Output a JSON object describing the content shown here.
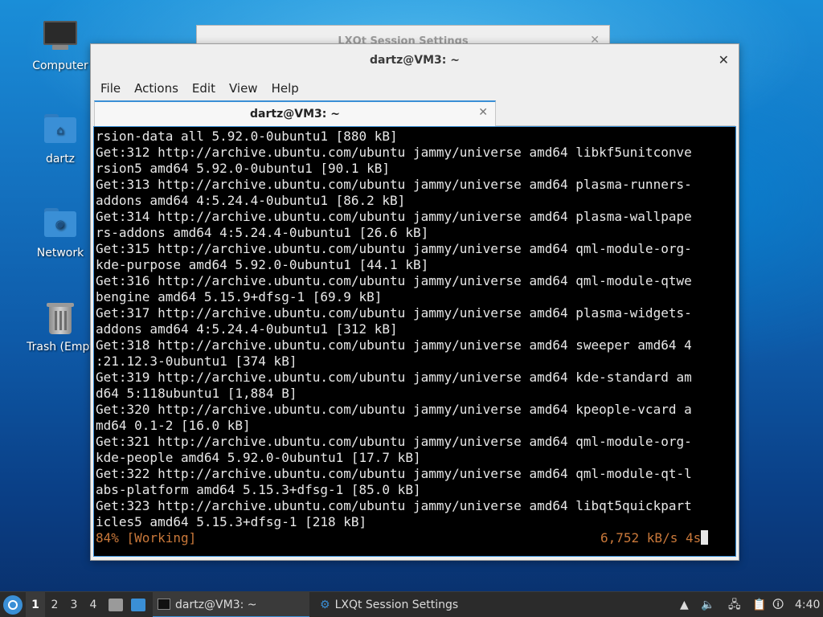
{
  "desktop": {
    "icons": [
      {
        "label": "Computer"
      },
      {
        "label": "dartz"
      },
      {
        "label": "Network"
      },
      {
        "label": "Trash (Empt"
      }
    ]
  },
  "background_window": {
    "title": "LXQt Session Settings"
  },
  "terminal_window": {
    "title": "dartz@VM3: ~",
    "menu": [
      "File",
      "Actions",
      "Edit",
      "View",
      "Help"
    ],
    "tab_title": "dartz@VM3: ~",
    "lines": [
      "rsion-data all 5.92.0-0ubuntu1 [880 kB]",
      "Get:312 http://archive.ubuntu.com/ubuntu jammy/universe amd64 libkf5unitconve",
      "rsion5 amd64 5.92.0-0ubuntu1 [90.1 kB]",
      "Get:313 http://archive.ubuntu.com/ubuntu jammy/universe amd64 plasma-runners-",
      "addons amd64 4:5.24.4-0ubuntu1 [86.2 kB]",
      "Get:314 http://archive.ubuntu.com/ubuntu jammy/universe amd64 plasma-wallpape",
      "rs-addons amd64 4:5.24.4-0ubuntu1 [26.6 kB]",
      "Get:315 http://archive.ubuntu.com/ubuntu jammy/universe amd64 qml-module-org-",
      "kde-purpose amd64 5.92.0-0ubuntu1 [44.1 kB]",
      "Get:316 http://archive.ubuntu.com/ubuntu jammy/universe amd64 qml-module-qtwe",
      "bengine amd64 5.15.9+dfsg-1 [69.9 kB]",
      "Get:317 http://archive.ubuntu.com/ubuntu jammy/universe amd64 plasma-widgets-",
      "addons amd64 4:5.24.4-0ubuntu1 [312 kB]",
      "Get:318 http://archive.ubuntu.com/ubuntu jammy/universe amd64 sweeper amd64 4",
      ":21.12.3-0ubuntu1 [374 kB]",
      "Get:319 http://archive.ubuntu.com/ubuntu jammy/universe amd64 kde-standard am",
      "d64 5:118ubuntu1 [1,884 B]",
      "Get:320 http://archive.ubuntu.com/ubuntu jammy/universe amd64 kpeople-vcard a",
      "md64 0.1-2 [16.0 kB]",
      "Get:321 http://archive.ubuntu.com/ubuntu jammy/universe amd64 qml-module-org-",
      "kde-people amd64 5.92.0-0ubuntu1 [17.7 kB]",
      "Get:322 http://archive.ubuntu.com/ubuntu jammy/universe amd64 qml-module-qt-l",
      "abs-platform amd64 5.15.3+dfsg-1 [85.0 kB]",
      "Get:323 http://archive.ubuntu.com/ubuntu jammy/universe amd64 libqt5quickpart",
      "icles5 amd64 5.15.3+dfsg-1 [218 kB]"
    ],
    "status_left": "84% [Working]",
    "status_right": "6,752 kB/s 4s"
  },
  "taskbar": {
    "workspaces": [
      "1",
      "2",
      "3",
      "4"
    ],
    "tasks": [
      {
        "label": "dartz@VM3: ~"
      },
      {
        "label": "LXQt Session Settings"
      }
    ],
    "clock": "4:40"
  },
  "colors": {
    "accent": "#3a8fd6",
    "status_orange": "#c9783a",
    "terminal_bg": "#000000"
  }
}
